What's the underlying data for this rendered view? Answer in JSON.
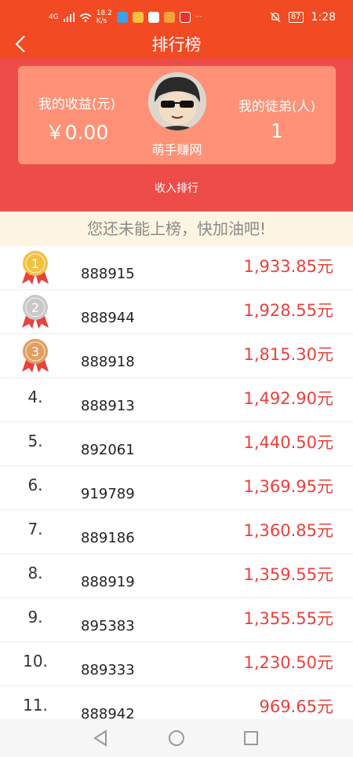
{
  "status": {
    "net": "4G",
    "speed_value": "18.2",
    "speed_unit": "K/s",
    "battery": "87",
    "time": "1:28",
    "more": "···"
  },
  "nav": {
    "title": "排行榜"
  },
  "summary": {
    "earnings_label": "我的收益(元)",
    "earnings_value": "￥0.00",
    "disciples_label": "我的徒弟(人)",
    "disciples_value": "1",
    "app_name": "萌手赚网",
    "tab_label": "收入排行"
  },
  "notice": "您还未能上榜，快加油吧!",
  "ranking": [
    {
      "rank": "1.",
      "user": "888915",
      "amount": "1,933.85元",
      "medal": "gold",
      "medal_num": "1"
    },
    {
      "rank": "2.",
      "user": "888944",
      "amount": "1,928.55元",
      "medal": "silver",
      "medal_num": "2"
    },
    {
      "rank": "3.",
      "user": "888918",
      "amount": "1,815.30元",
      "medal": "bronze",
      "medal_num": "3"
    },
    {
      "rank": "4.",
      "user": "888913",
      "amount": "1,492.90元"
    },
    {
      "rank": "5.",
      "user": "892061",
      "amount": "1,440.50元"
    },
    {
      "rank": "6.",
      "user": "919789",
      "amount": "1,369.95元"
    },
    {
      "rank": "7.",
      "user": "889186",
      "amount": "1,360.85元"
    },
    {
      "rank": "8.",
      "user": "888919",
      "amount": "1,359.55元"
    },
    {
      "rank": "9.",
      "user": "895383",
      "amount": "1,355.55元"
    },
    {
      "rank": "10.",
      "user": "889333",
      "amount": "1,230.50元"
    },
    {
      "rank": "11.",
      "user": "888942",
      "amount": "969.65元"
    }
  ],
  "colors": {
    "header": "#f24a22",
    "hero": "#ee4c48",
    "card": "#fe9176",
    "amount": "#e9413c",
    "gold": "#f2c142",
    "silver": "#c9c9c9",
    "bronze": "#e0a060",
    "ribbon": "#e9413c"
  }
}
